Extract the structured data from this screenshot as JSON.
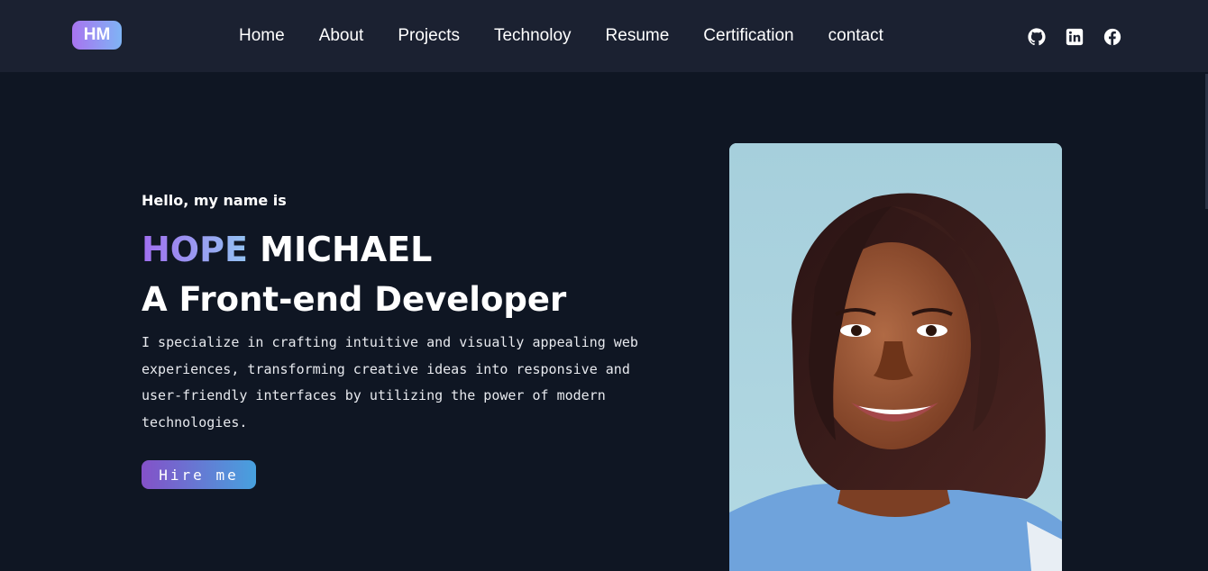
{
  "header": {
    "logo": "HM",
    "nav": [
      "Home",
      "About",
      "Projects",
      "Technoloy",
      "Resume",
      "Certification",
      "contact"
    ],
    "socials": [
      "github-icon",
      "linkedin-icon",
      "facebook-icon"
    ]
  },
  "hero": {
    "greeting": "Hello, my name is",
    "first_name": "HOPE",
    "last_name": "MICHAEL",
    "role": "A Front-end Developer",
    "bio": "I specialize in crafting intuitive and visually appealing web experiences, transforming creative ideas into responsive and user-friendly interfaces by utilizing the power of modern technologies.",
    "cta": "Hire me"
  },
  "colors": {
    "page_bg": "#0f1623",
    "navbar_bg": "#1b2131",
    "accent_gradient_start": "#a874f0",
    "accent_gradient_end": "#7fb4f5",
    "button_gradient_start": "#8451c8",
    "button_gradient_end": "#47a1de"
  }
}
